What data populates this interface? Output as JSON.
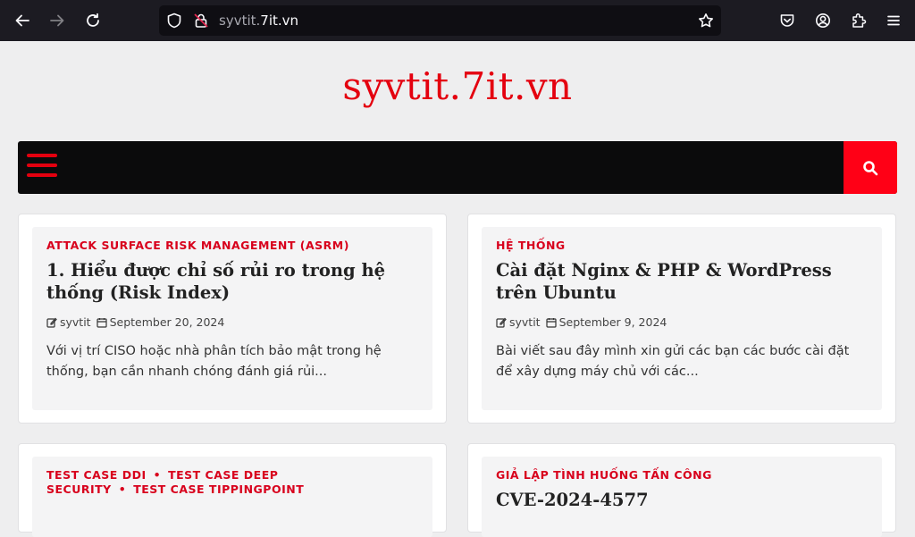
{
  "browser": {
    "url_host_dim": "syvtit.",
    "url_host_main": "7it.vn"
  },
  "site": {
    "title": "syvtit.7it.vn"
  },
  "posts": [
    {
      "categories": [
        "ATTACK SURFACE RISK MANAGEMENT (ASRM)"
      ],
      "title": "1. Hiểu được chỉ số rủi ro trong hệ thống (Risk Index)",
      "author": "syvtit",
      "date": "September 20, 2024",
      "excerpt": "Với vị trí CISO hoặc nhà phân tích bảo mật trong hệ thống, bạn cần nhanh chóng đánh giá rủi..."
    },
    {
      "categories": [
        "HỆ THỐNG"
      ],
      "title": "Cài đặt Nginx & PHP & WordPress trên Ubuntu",
      "author": "syvtit",
      "date": "September 9, 2024",
      "excerpt": "Bài viết sau đây mình xin gửi các bạn các bước cài đặt để xây dựng máy chủ với các..."
    },
    {
      "categories": [
        "TEST CASE DDI",
        "TEST CASE DEEP SECURITY",
        "TEST CASE TIPPINGPOINT"
      ],
      "separator": "•"
    },
    {
      "categories": [
        "GIẢ LẬP TÌNH HUỐNG TẤN CÔNG"
      ],
      "title": "CVE-2024-4577"
    }
  ],
  "colors": {
    "accent": "#e4000f",
    "navbar": "#0b0b0c",
    "search_bg": "#ff0016",
    "page_bg": "#eeeeef"
  },
  "icons": {
    "back": "arrow-left-icon",
    "forward": "arrow-right-icon",
    "reload": "reload-icon",
    "shield": "shield-icon",
    "lock": "insecure-lock-icon",
    "bookmark": "star-icon",
    "pocket": "pocket-icon",
    "account": "account-icon",
    "extensions": "puzzle-icon",
    "menu": "hamburger-icon",
    "search": "search-icon",
    "author": "edit-icon",
    "date": "calendar-icon"
  }
}
